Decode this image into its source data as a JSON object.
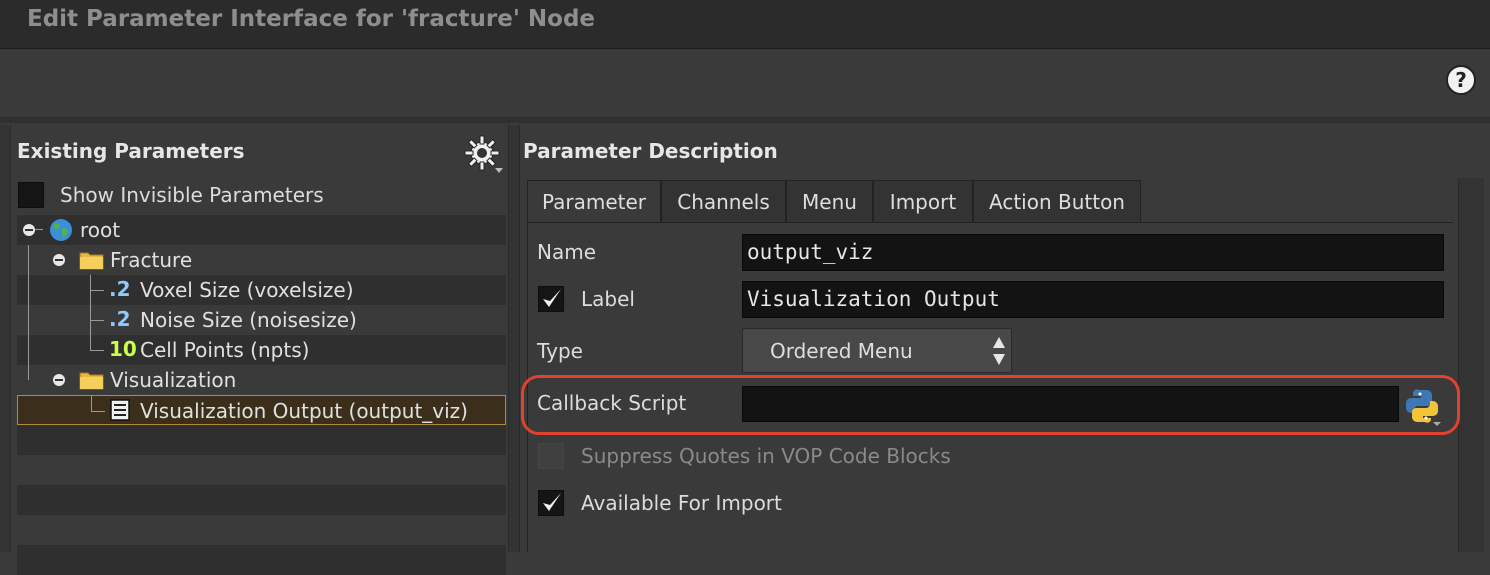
{
  "window": {
    "title": "Edit Parameter Interface for 'fracture' Node"
  },
  "left_panel": {
    "heading": "Existing Parameters",
    "show_invisible_label": "Show Invisible Parameters",
    "tree": [
      {
        "label": "root",
        "icon": "globe-icon"
      },
      {
        "label": "Fracture",
        "icon": "folder-icon"
      },
      {
        "label": "Voxel Size (voxelsize)",
        "icon": "float-icon",
        "icon_text": ".2"
      },
      {
        "label": "Noise Size (noisesize)",
        "icon": "float-icon",
        "icon_text": ".2"
      },
      {
        "label": "Cell Points (npts)",
        "icon": "int-icon",
        "icon_text": "10"
      },
      {
        "label": "Visualization",
        "icon": "folder-icon"
      },
      {
        "label": "Visualization Output (output_viz)",
        "icon": "menu-param-icon"
      }
    ]
  },
  "right_panel": {
    "heading": "Parameter Description",
    "tabs": [
      {
        "label": "Parameter"
      },
      {
        "label": "Channels"
      },
      {
        "label": "Menu"
      },
      {
        "label": "Import"
      },
      {
        "label": "Action Button"
      }
    ],
    "fields": {
      "name_label": "Name",
      "name_value": "output_viz",
      "label_label": "Label",
      "label_value": "Visualization Output",
      "type_label": "Type",
      "type_value": "Ordered Menu",
      "callback_label": "Callback Script",
      "callback_value": "",
      "suppress_label": "Suppress Quotes in VOP Code Blocks",
      "available_label": "Available For Import"
    }
  },
  "colors": {
    "highlight": "#e0432b",
    "selection_border": "#b58b35"
  }
}
